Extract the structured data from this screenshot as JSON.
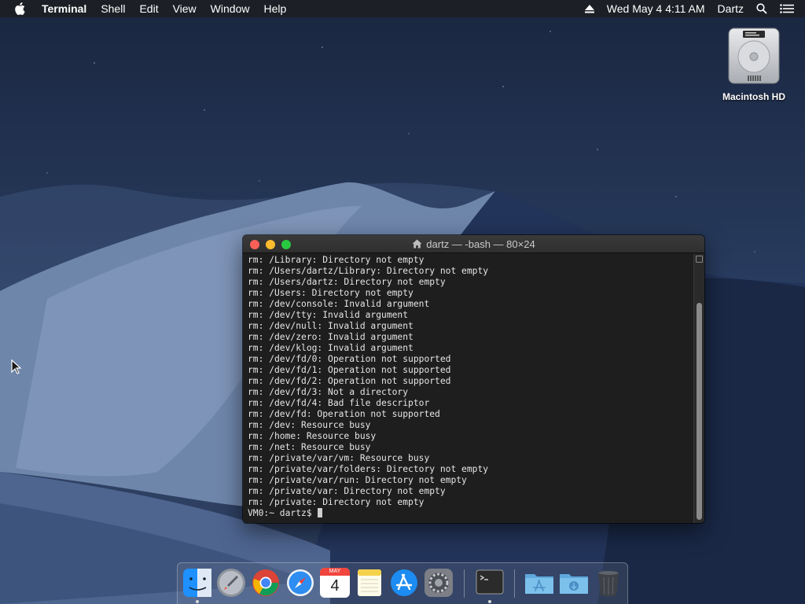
{
  "menubar": {
    "apple_icon": "apple-icon",
    "app_name": "Terminal",
    "menus": [
      "Shell",
      "Edit",
      "View",
      "Window",
      "Help"
    ],
    "eject_icon": "eject-icon",
    "clock": "Wed May 4  4:11 AM",
    "user": "Dartz",
    "search_icon": "spotlight-search-icon",
    "notification_icon": "notification-center-icon"
  },
  "desktop": {
    "drive_label": "Macintosh HD"
  },
  "terminal": {
    "title": "dartz — -bash — 80×24",
    "lines": [
      "rm: /Library: Directory not empty",
      "rm: /Users/dartz/Library: Directory not empty",
      "rm: /Users/dartz: Directory not empty",
      "rm: /Users: Directory not empty",
      "rm: /dev/console: Invalid argument",
      "rm: /dev/tty: Invalid argument",
      "rm: /dev/null: Invalid argument",
      "rm: /dev/zero: Invalid argument",
      "rm: /dev/klog: Invalid argument",
      "rm: /dev/fd/0: Operation not supported",
      "rm: /dev/fd/1: Operation not supported",
      "rm: /dev/fd/2: Operation not supported",
      "rm: /dev/fd/3: Not a directory",
      "rm: /dev/fd/4: Bad file descriptor",
      "rm: /dev/fd: Operation not supported",
      "rm: /dev: Resource busy",
      "rm: /home: Resource busy",
      "rm: /net: Resource busy",
      "rm: /private/var/vm: Resource busy",
      "rm: /private/var/folders: Directory not empty",
      "rm: /private/var/run: Directory not empty",
      "rm: /private/var: Directory not empty",
      "rm: /private: Directory not empty"
    ],
    "prompt": "VM0:~ dartz$ "
  },
  "dock": {
    "calendar_month": "MAY",
    "calendar_day": "4",
    "items": [
      "finder",
      "launchpad",
      "chrome",
      "safari",
      "calendar",
      "notes",
      "app-store",
      "system-preferences",
      "terminal",
      "applications-folder",
      "downloads-folder",
      "trash"
    ]
  },
  "colors": {
    "close": "#fc5f57",
    "minimize": "#fdbc2e",
    "maximize": "#28c840",
    "terminal_bg": "#1e1e1e",
    "terminal_text": "#e6e6e6"
  }
}
